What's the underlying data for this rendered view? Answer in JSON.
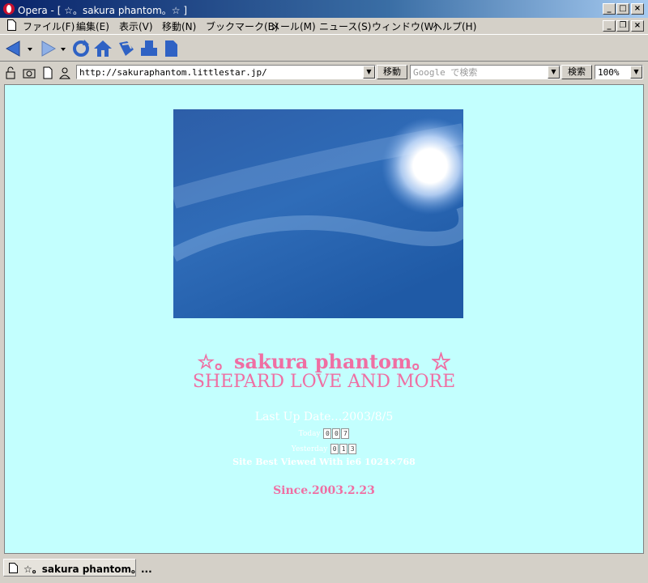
{
  "window": {
    "title": "Opera - [ ☆。sakura phantom。☆ ]"
  },
  "menu": {
    "items": [
      "ファイル(F)",
      "編集(E)",
      "表示(V)",
      "移動(N)",
      "ブックマーク(B)",
      "メール(M)",
      "ニュース(S)",
      "ウィンドウ(W)",
      "ヘルプ(H)"
    ]
  },
  "toolbar": {
    "address": "http://sakuraphantom.littlestar.jp/",
    "go_label": "移動",
    "search_placeholder": "Google で検索",
    "search_label": "検索",
    "zoom": "100%"
  },
  "page": {
    "title_line1": "☆。sakura phantom。☆",
    "title_line2": "SHEPARD LOVE AND MORE",
    "last_update": "Last Up Date…2003/8/5",
    "today_label": "Today",
    "today_digits": [
      "0",
      "0",
      "7"
    ],
    "yesterday_label": "Yesterday",
    "yesterday_digits": [
      "0",
      "1",
      "3"
    ],
    "best_viewed": "Site Best Viewed With ie6 1024×768",
    "since": "Since.2003.2.23"
  },
  "tabbar": {
    "tab_label": "☆。sakura phantom。..."
  },
  "colors": {
    "page_background": "#c3fffe",
    "title_pink": "#ef6fa3",
    "titlebar_blue": "#0a246a"
  }
}
